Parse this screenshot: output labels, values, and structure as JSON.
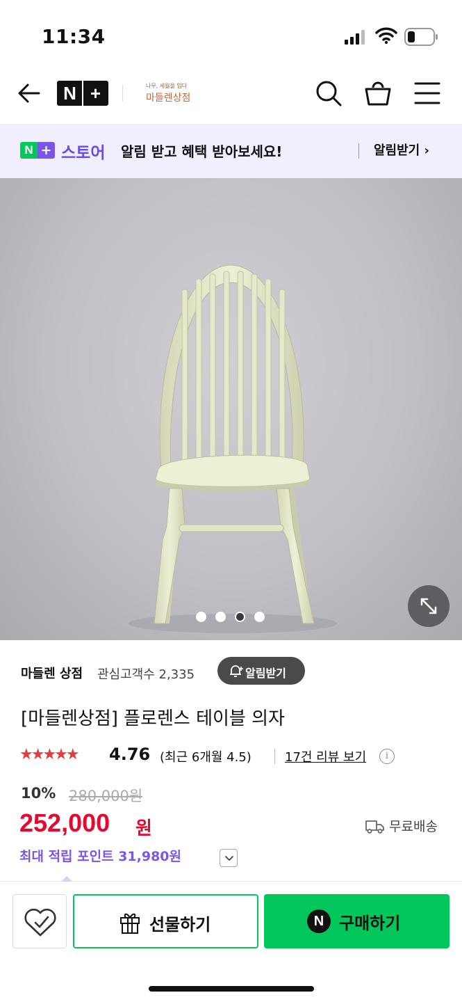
{
  "status_bar": {
    "time": "11:34"
  },
  "nav": {
    "brand_logo": "N+",
    "store_logo_sub": "나무, 세월을 입다",
    "store_logo_main": "마들렌상점",
    "icons": [
      "back-arrow-icon",
      "search-icon",
      "cart-icon",
      "menu-icon"
    ]
  },
  "promo": {
    "badge_n": "N",
    "badge_plus": "+",
    "store_word": "스토어",
    "message": "알림 받고 혜택 받아보세요!",
    "cta": "알림받기 ›"
  },
  "gallery": {
    "total_images": 4,
    "active_index": 3
  },
  "store": {
    "name": "마들렌 상점",
    "fans": "관심고객수 2,335",
    "alert_button": "알림받기"
  },
  "product": {
    "title": "[마들렌상점] 플로렌스 테이블 의자",
    "stars": "★★★★★",
    "rating_value": 4.76,
    "rating": "4.76",
    "recent_rating": "(최근 6개월 4.5)",
    "reviews_link": "17건 리뷰 보기",
    "info_icon_glyph": "i",
    "discount": "10%",
    "original_price": "280,000원",
    "price": "252,000",
    "price_unit": "원",
    "shipping": "무료배송",
    "points": "최대 적립 포인트 31,980원"
  },
  "bottom_bar": {
    "gift_label": "선물하기",
    "buy_logo": "N",
    "buy_label": "구매하기"
  },
  "colors": {
    "naver_green": "#03c75a",
    "naver_purple": "#7b55e6",
    "price_red": "#e40a2f",
    "star_red": "#e03e3e",
    "promo_bg": "#f1effd"
  }
}
